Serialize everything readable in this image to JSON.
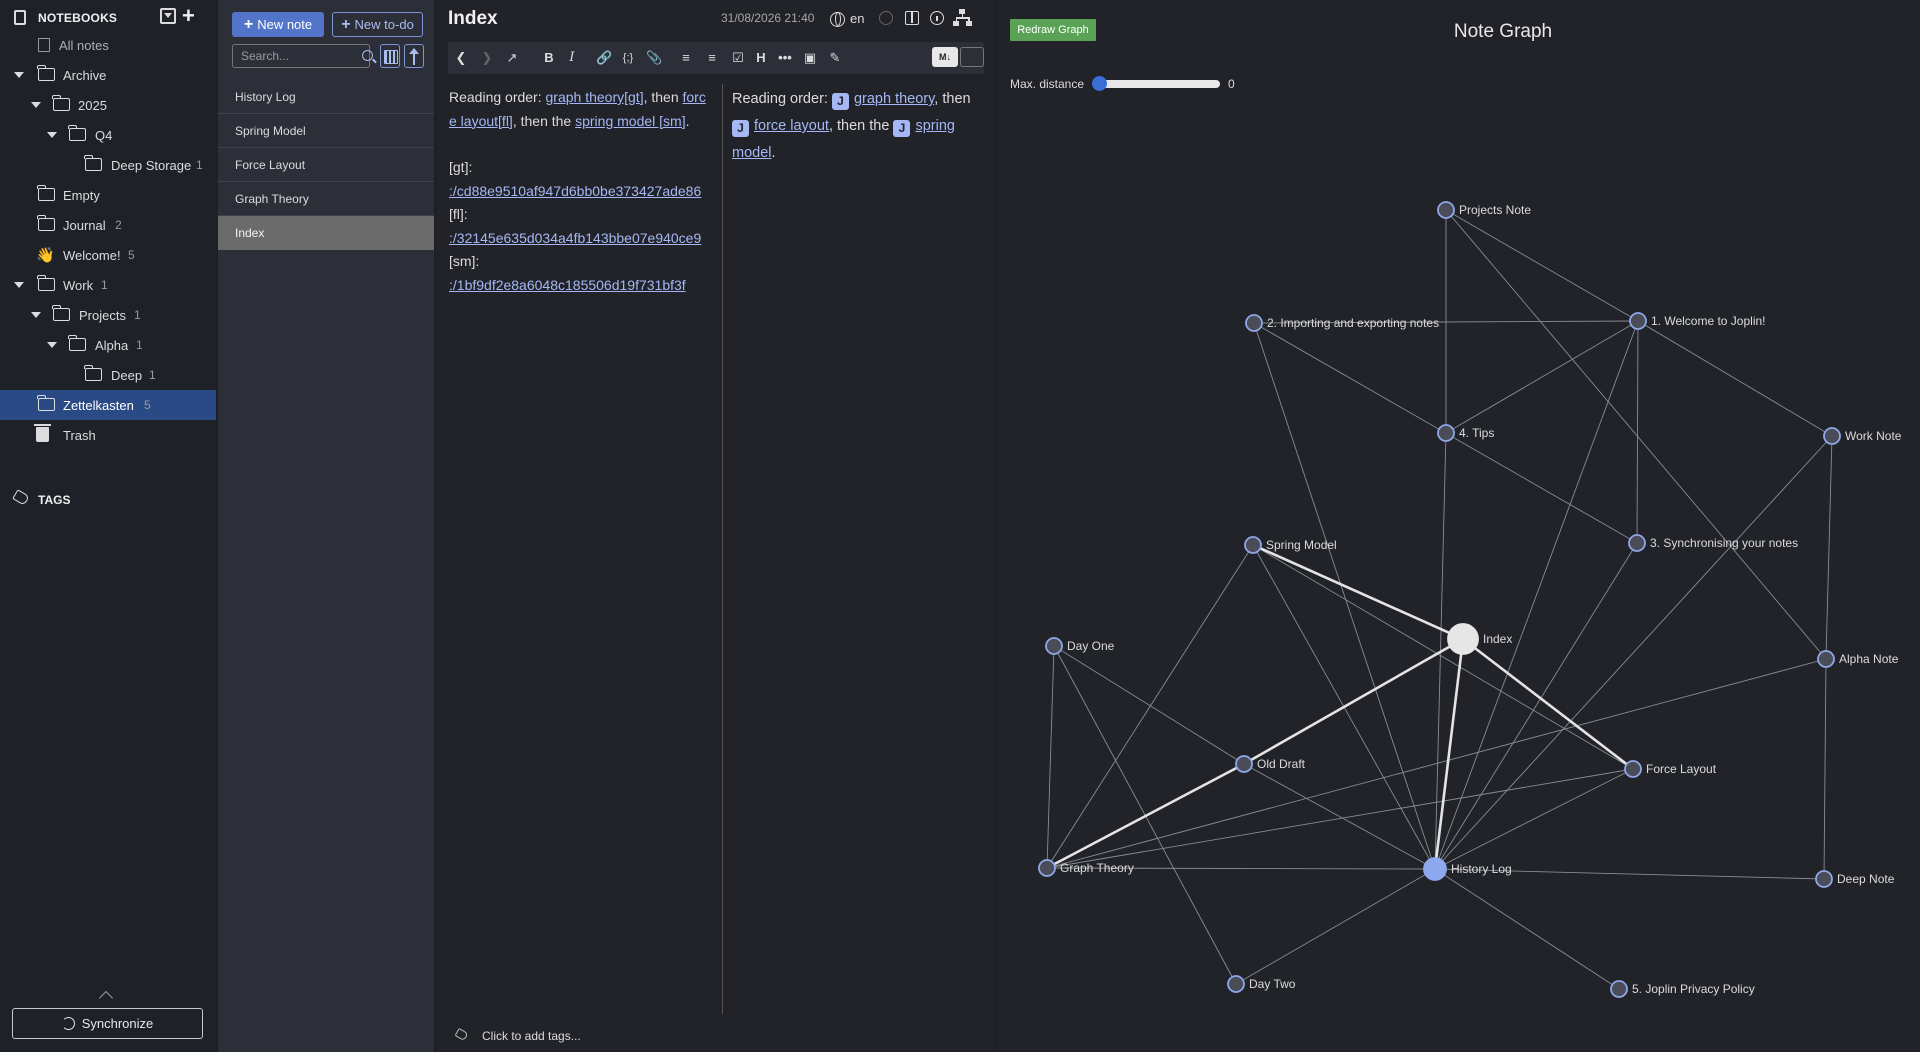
{
  "sidebar": {
    "title": "NOTEBOOKS",
    "all_notes": "All notes",
    "tree": [
      {
        "label": "Archive"
      },
      {
        "label": "2025"
      },
      {
        "label": "Q4"
      },
      {
        "label": "Deep Storage",
        "count": "1"
      },
      {
        "label": "Empty"
      },
      {
        "label": "Journal",
        "count": "2"
      },
      {
        "label": "Welcome!",
        "count": "5",
        "icon": "👋"
      },
      {
        "label": "Work",
        "count": "1"
      },
      {
        "label": "Projects",
        "count": "1"
      },
      {
        "label": "Alpha",
        "count": "1"
      },
      {
        "label": "Deep",
        "count": "1"
      },
      {
        "label": "Zettelkasten",
        "count": "5",
        "selected": true
      },
      {
        "label": "Trash"
      }
    ],
    "tags_title": "TAGS",
    "sync_label": "Synchronize"
  },
  "notelist": {
    "new_note": "New note",
    "new_todo": "New to-do",
    "search_placeholder": "Search...",
    "notes": [
      "History Log",
      "Spring Model",
      "Force Layout",
      "Graph Theory",
      "Index"
    ],
    "selected_index": 4
  },
  "editor": {
    "title": "Index",
    "date": "31/08/2026 21:40",
    "lang": "en",
    "markdown": {
      "line1_prefix": "Reading order: ",
      "link1": "graph theory[gt]",
      "sep1": ", then ",
      "link2": "force layout[fl]",
      "sep2": ", then the ",
      "link3": "spring model [sm]",
      "end": ".",
      "ref_gt_label": "[gt]:",
      "ref_gt": ":/cd88e9510af947d6bb0be373427ade86",
      "ref_fl_label": "[fl]:",
      "ref_fl": ":/32145e635d034a4fb143bbe07e940ce9",
      "ref_sm_label": "[sm]:",
      "ref_sm": ":/1bf9df2e8a6048c185506d19f731bf3f"
    },
    "preview": {
      "prefix": "Reading order: ",
      "link1": "graph theory",
      "sep1": ", then",
      "link2": "force layout",
      "sep2": ", then the",
      "link3": "spring model",
      "end": "."
    },
    "tag_prompt": "Click to add tags..."
  },
  "graph": {
    "title": "Note Graph",
    "redraw_label": "Redraw Graph",
    "distance_label": "Max. distance",
    "distance_value": "0",
    "nodes": [
      {
        "id": "projects",
        "label": "Projects Note"
      },
      {
        "id": "importing",
        "label": "2. Importing and exporting notes"
      },
      {
        "id": "welcome",
        "label": "1. Welcome to Joplin!"
      },
      {
        "id": "tips",
        "label": "4. Tips"
      },
      {
        "id": "worknote",
        "label": "Work Note"
      },
      {
        "id": "spring",
        "label": "Spring Model"
      },
      {
        "id": "sync",
        "label": "3. Synchronising your notes"
      },
      {
        "id": "index",
        "label": "Index"
      },
      {
        "id": "dayone",
        "label": "Day One"
      },
      {
        "id": "alpha",
        "label": "Alpha Note"
      },
      {
        "id": "olddraft",
        "label": "Old Draft"
      },
      {
        "id": "force",
        "label": "Force Layout"
      },
      {
        "id": "graphtheory",
        "label": "Graph Theory"
      },
      {
        "id": "history",
        "label": "History Log"
      },
      {
        "id": "deepnote",
        "label": "Deep Note"
      },
      {
        "id": "daytwo",
        "label": "Day Two"
      },
      {
        "id": "privacy",
        "label": "5. Joplin Privacy Policy"
      }
    ]
  },
  "colors": {
    "accent": "#5275c9",
    "selected_folder": "#2a4a85",
    "link": "#a5b8f5",
    "node_fill": "#4a4d57",
    "node_stroke": "#8fa6e8",
    "history_node": "#8ea8f0",
    "index_node": "#e6e6e6",
    "redraw": "#5aa356"
  }
}
